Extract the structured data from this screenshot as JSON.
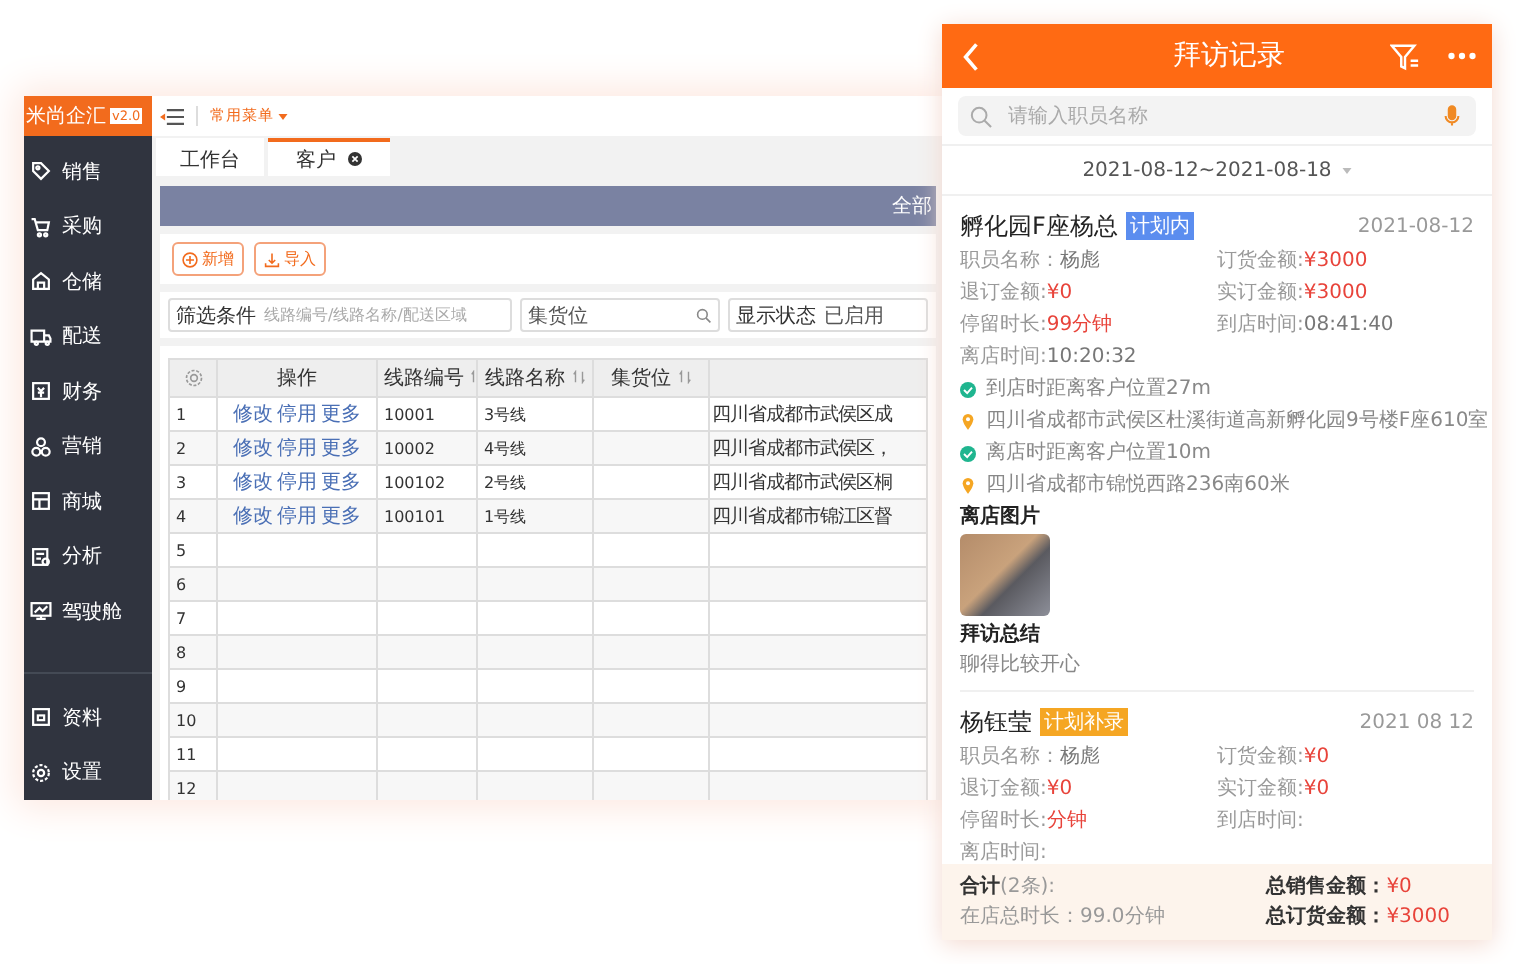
{
  "desktop": {
    "logo": {
      "text": "米尚企汇",
      "version": "v2.0"
    },
    "quick_menu": "常用菜单",
    "sidebar": {
      "items": [
        {
          "label": "销售"
        },
        {
          "label": "采购"
        },
        {
          "label": "仓储"
        },
        {
          "label": "配送"
        },
        {
          "label": "财务"
        },
        {
          "label": "营销"
        },
        {
          "label": "商城"
        },
        {
          "label": "分析"
        },
        {
          "label": "驾驶舱"
        }
      ],
      "bottom_items": [
        {
          "label": "资料"
        },
        {
          "label": "设置"
        }
      ]
    },
    "tabs": [
      {
        "label": "工作台",
        "selected": false,
        "closable": false
      },
      {
        "label": "客户",
        "selected": true,
        "closable": true
      }
    ],
    "band_text": "全部",
    "buttons": [
      {
        "label": "新增",
        "kind": "add"
      },
      {
        "label": "导入",
        "kind": "import"
      }
    ],
    "filters": [
      {
        "label": "筛选条件",
        "placeholder": "线路编号/线路名称/配送区域",
        "search": false
      },
      {
        "placeholder": "集货位",
        "search": true
      },
      {
        "label": "显示状态",
        "value": "已启用",
        "search": false
      }
    ],
    "table": {
      "columns": [
        {
          "label": "操作",
          "sortable": false
        },
        {
          "label": "线路编号",
          "sortable": true
        },
        {
          "label": "线路名称",
          "sortable": true
        },
        {
          "label": "集货位",
          "sortable": true
        }
      ],
      "rows": [
        {
          "no": "1",
          "actions": [
            "修改",
            "停用",
            "更多"
          ],
          "code": "10001",
          "name": "3号线",
          "slot": "",
          "address": "四川省成都市武侯区成"
        },
        {
          "no": "2",
          "actions": [
            "修改",
            "停用",
            "更多"
          ],
          "code": "10002",
          "name": "4号线",
          "slot": "",
          "address": "四川省成都市武侯区，"
        },
        {
          "no": "3",
          "actions": [
            "修改",
            "停用",
            "更多"
          ],
          "code": "100102",
          "name": "2号线",
          "slot": "",
          "address": "四川省成都市武侯区桐"
        },
        {
          "no": "4",
          "actions": [
            "修改",
            "停用",
            "更多"
          ],
          "code": "100101",
          "name": "1号线",
          "slot": "",
          "address": "四川省成都市锦江区督"
        },
        {
          "no": "5"
        },
        {
          "no": "6"
        },
        {
          "no": "7"
        },
        {
          "no": "8"
        },
        {
          "no": "9"
        },
        {
          "no": "10"
        },
        {
          "no": "11"
        },
        {
          "no": "12"
        }
      ]
    }
  },
  "phone": {
    "title": "拜访记录",
    "search_placeholder": "请输入职员名称",
    "date_range": "2021-08-12~2021-08-18",
    "visits": [
      {
        "name": "孵化园F座杨总",
        "tag": {
          "text": "计划内",
          "color": "#5b8def"
        },
        "date": "2021-08-12",
        "fields": [
          {
            "label": "职员名称：",
            "value": "杨彪",
            "accent": false
          },
          {
            "label": "订货金额:",
            "value": "¥3000",
            "accent": true
          },
          {
            "label": "退订金额:",
            "value": "¥0",
            "accent": true
          },
          {
            "label": "实订金额:",
            "value": "¥3000",
            "accent": true
          },
          {
            "label": "停留时长:",
            "value": "99分钟",
            "accent": true
          },
          {
            "label": "到店时间:",
            "value": "08:41:40",
            "accent": false
          },
          {
            "label": "离店时间:",
            "value": "10:20:32",
            "accent": false
          }
        ],
        "locations": [
          {
            "kind": "distance",
            "text": "到店时距离客户位置27m"
          },
          {
            "kind": "address",
            "text": "四川省成都市武侯区杜溪街道高新孵化园9号楼F座610室"
          },
          {
            "kind": "distance",
            "text": "离店时距离客户位置10m"
          },
          {
            "kind": "address",
            "text": "四川省成都市锦悦西路236南60米"
          }
        ],
        "photo_title": "离店图片",
        "summary_title": "拜访总结",
        "summary": "聊得比较开心"
      },
      {
        "name": "杨钰莹",
        "tag": {
          "text": "计划补录",
          "color": "#f5a623"
        },
        "date": "2021 08 12",
        "fields": [
          {
            "label": "职员名称：",
            "value": "杨彪",
            "accent": false
          },
          {
            "label": "订货金额:",
            "value": "¥0",
            "accent": true
          },
          {
            "label": "退订金额:",
            "value": "¥0",
            "accent": true
          },
          {
            "label": "实订金额:",
            "value": "¥0",
            "accent": true
          },
          {
            "label": "停留时长:",
            "value": "分钟",
            "accent": true
          },
          {
            "label": "到店时间:"
          },
          {
            "label": "离店时间:"
          }
        ]
      }
    ],
    "footer": {
      "total_label": "合计",
      "total_count": "(2条):",
      "duration": "在店总时长：99.0分钟",
      "sales_label": "总销售金额：",
      "sales": "¥0",
      "order_label": "总订货金额：",
      "order": "¥3000"
    }
  }
}
